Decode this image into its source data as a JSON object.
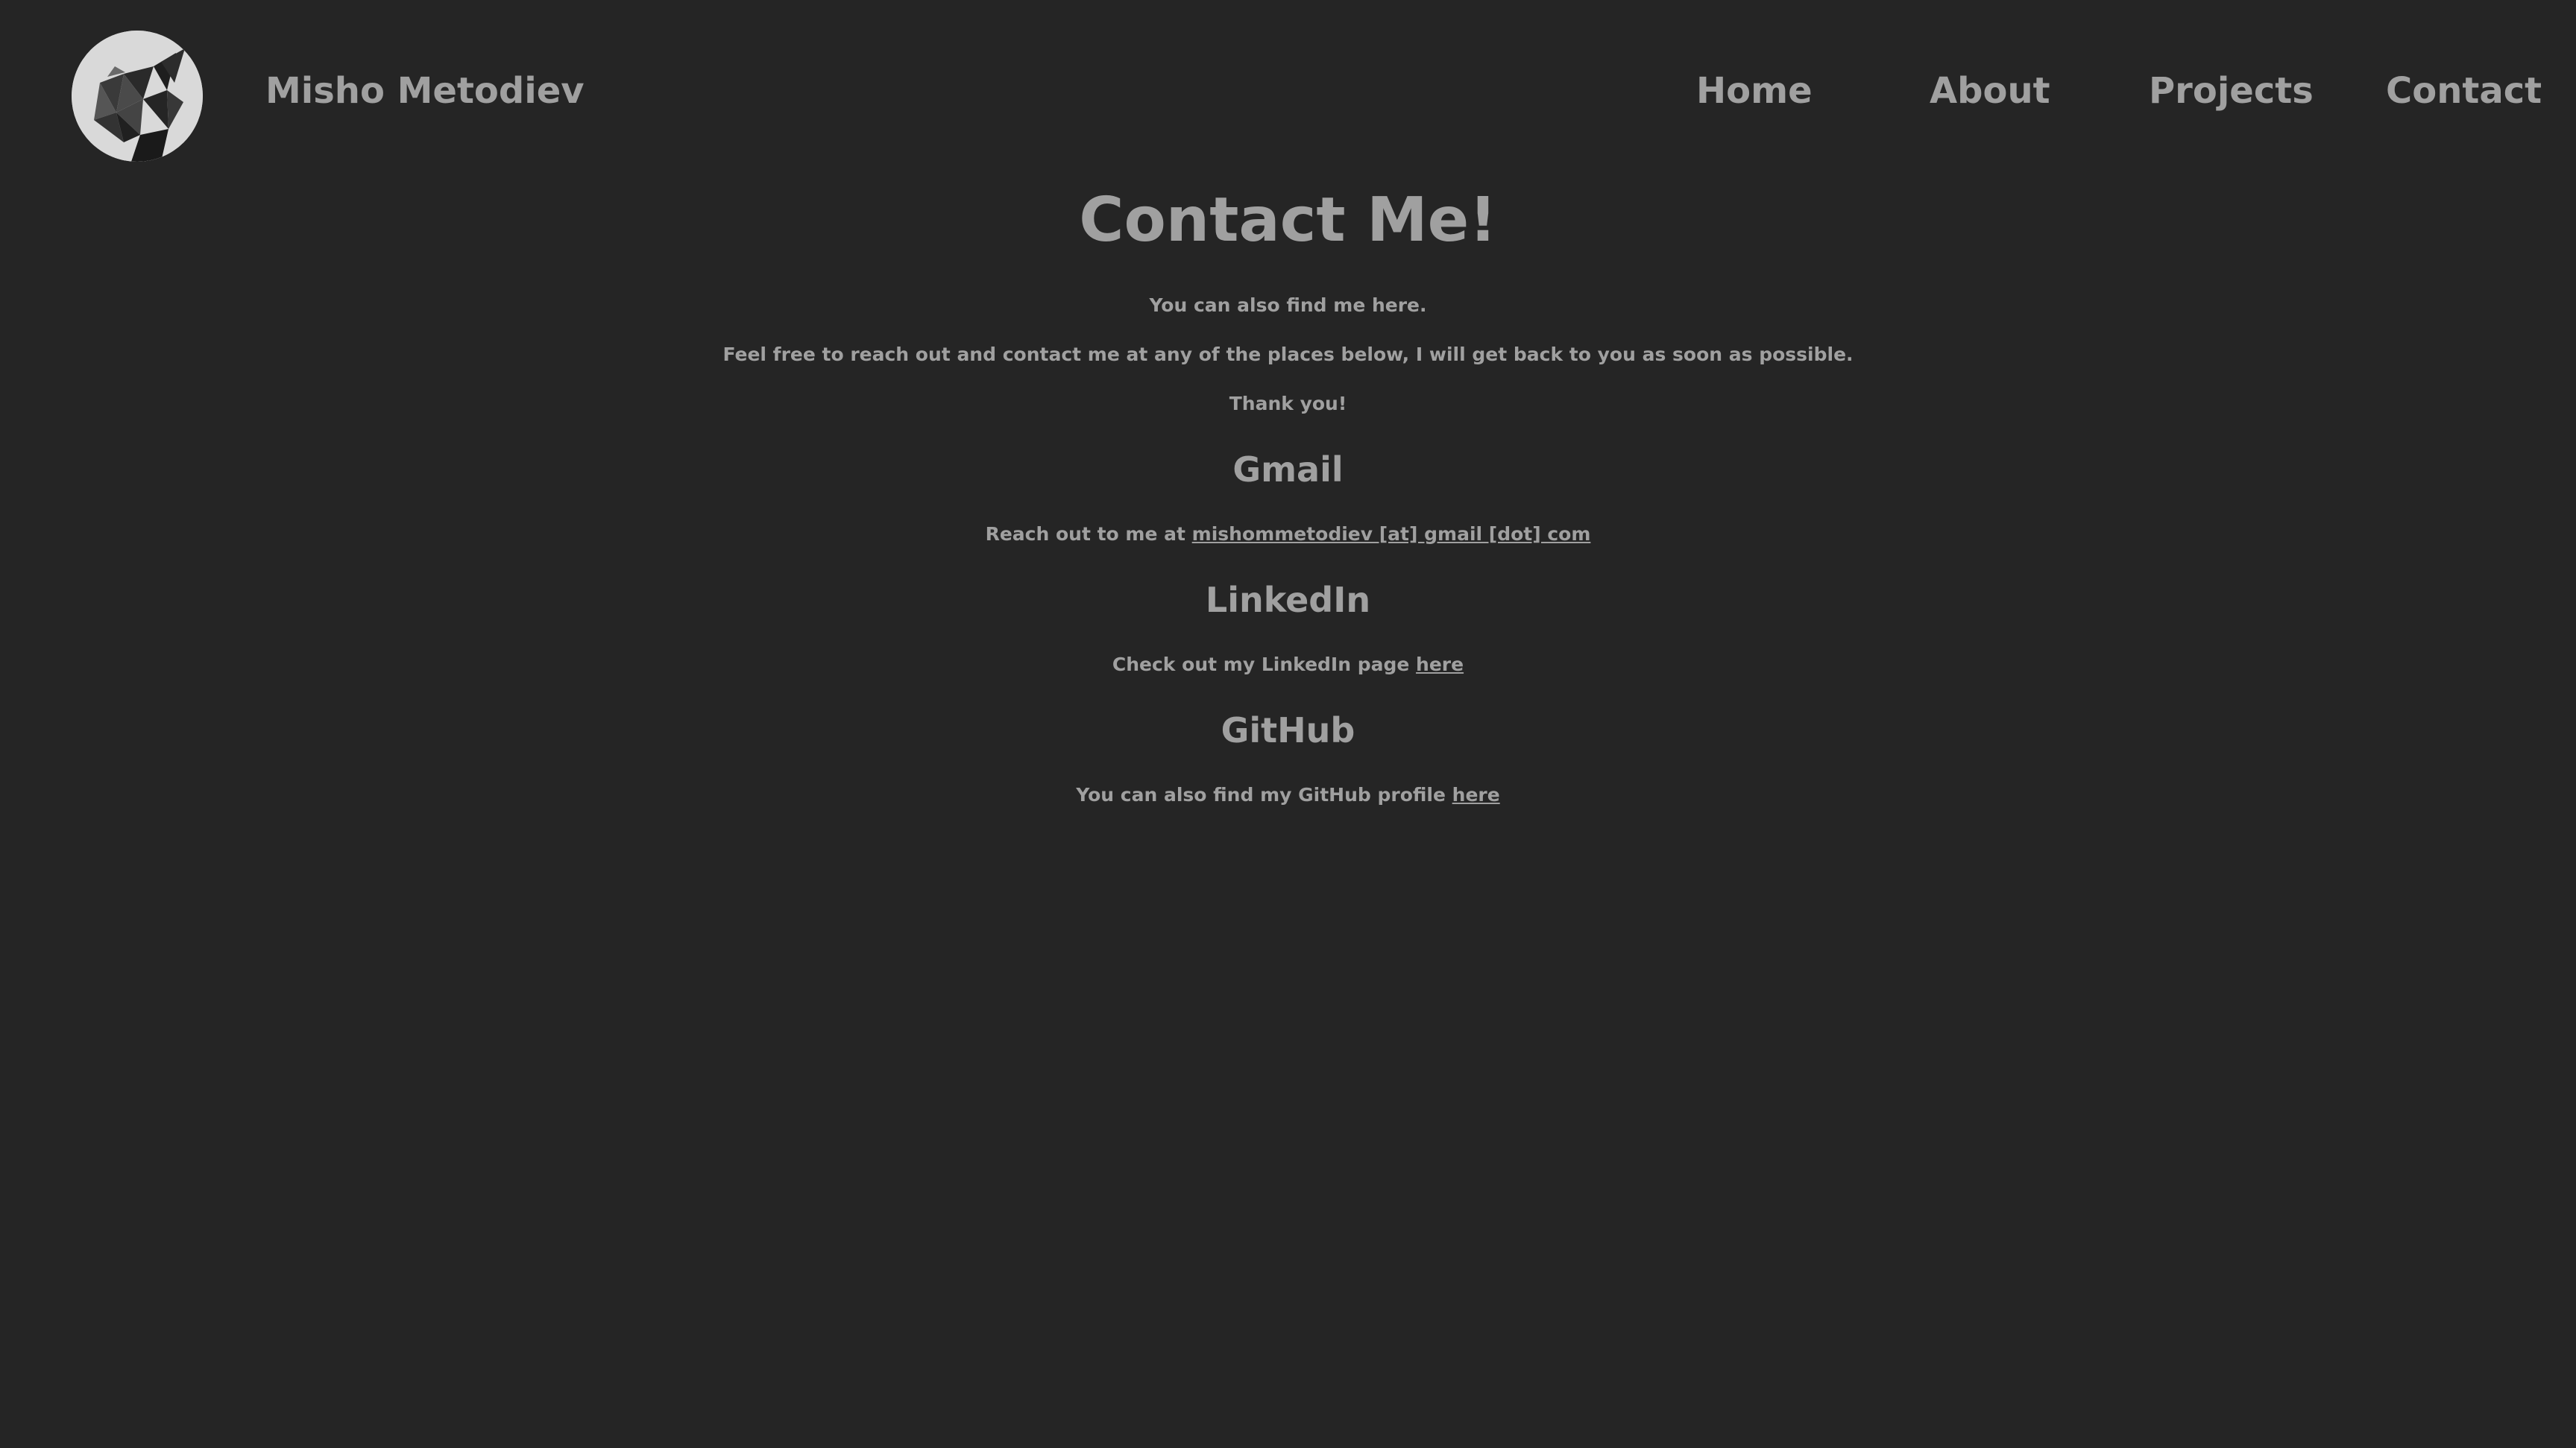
{
  "header": {
    "site_name": "Misho Metodiev",
    "nav": {
      "home": "Home",
      "about": "About",
      "projects": "Projects",
      "contact": "Contact"
    }
  },
  "main": {
    "title": "Contact Me!",
    "intro": "You can also find me here.",
    "description": "Feel free to reach out and contact me at any of the places below, I will get back to you as soon as possible.",
    "thanks": "Thank you!",
    "gmail": {
      "heading": "Gmail",
      "text": "Reach out to me at ",
      "link": "mishommetodiev [at] gmail [dot] com"
    },
    "linkedin": {
      "heading": "LinkedIn",
      "text": "Check out my LinkedIn page ",
      "link": "here"
    },
    "github": {
      "heading": "GitHub",
      "text": "You can also find my GitHub profile ",
      "link": "here"
    }
  },
  "colors": {
    "background": "#252525",
    "text": "#a0a0a0",
    "avatar_bg": "#d9d9d9"
  }
}
